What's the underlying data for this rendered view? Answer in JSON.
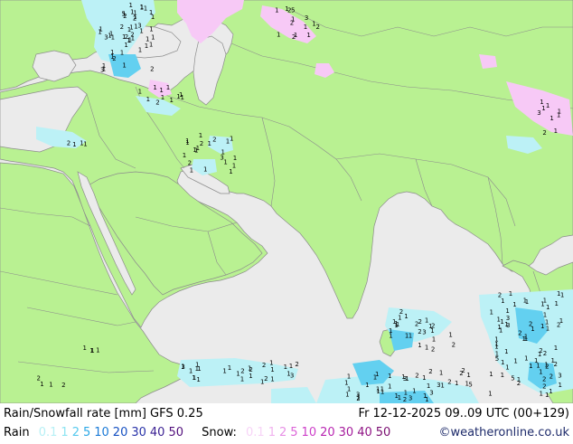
{
  "header": {
    "title": "Rain/Snowfall rate [mm] GFS 0.25",
    "valid_time": "Fr 12-12-2025 09..09 UTC (00+129)"
  },
  "legend": {
    "rain_label": "Rain",
    "rain_ticks": [
      {
        "text": "0.1",
        "color": "#b7f0f5"
      },
      {
        "text": "1",
        "color": "#8de4f2"
      },
      {
        "text": "2",
        "color": "#56c9ee"
      },
      {
        "text": "5",
        "color": "#2aa7e6"
      },
      {
        "text": "10",
        "color": "#1a7ad7"
      },
      {
        "text": "20",
        "color": "#1550c2"
      },
      {
        "text": "30",
        "color": "#2832a8"
      },
      {
        "text": "40",
        "color": "#3a1f92"
      },
      {
        "text": "50",
        "color": "#52107c"
      }
    ],
    "snow_label": "Snow:",
    "snow_ticks": [
      {
        "text": "0.1",
        "color": "#f7d4f7"
      },
      {
        "text": "1",
        "color": "#f1b2ef"
      },
      {
        "text": "2",
        "color": "#e790e6"
      },
      {
        "text": "5",
        "color": "#dc64d8"
      },
      {
        "text": "10",
        "color": "#cd3fc9"
      },
      {
        "text": "20",
        "color": "#b927b2"
      },
      {
        "text": "30",
        "color": "#a51b9c"
      },
      {
        "text": "40",
        "color": "#8f1384"
      },
      {
        "text": "50",
        "color": "#7a0d70"
      }
    ],
    "credit": "©weatheronline.co.uk"
  },
  "colors": {
    "sea": "#ebebeb",
    "land": "#b9f192",
    "border": "#8c8c8c",
    "rain_light": "#bcf1f6",
    "rain_mid": "#63d0f0",
    "snow_light": "#f7c9f6"
  },
  "map": {
    "precip_digits": [
      "1",
      "2",
      "3",
      "5"
    ]
  }
}
